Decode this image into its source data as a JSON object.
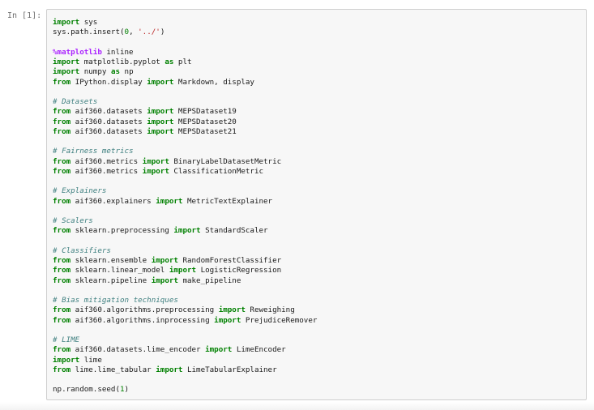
{
  "cell": {
    "prompt": "In [1]:",
    "lines": [
      [
        {
          "t": "import",
          "c": "kw"
        },
        {
          "t": " sys",
          "c": ""
        }
      ],
      [
        {
          "t": "sys.path.insert(",
          "c": ""
        },
        {
          "t": "0",
          "c": "num"
        },
        {
          "t": ", ",
          "c": ""
        },
        {
          "t": "'../'",
          "c": "str"
        },
        {
          "t": ")",
          "c": ""
        }
      ],
      [],
      [
        {
          "t": "%matplotlib",
          "c": "mg"
        },
        {
          "t": " inline",
          "c": ""
        }
      ],
      [
        {
          "t": "import",
          "c": "kw"
        },
        {
          "t": " matplotlib.pyplot ",
          "c": ""
        },
        {
          "t": "as",
          "c": "kw"
        },
        {
          "t": " plt",
          "c": ""
        }
      ],
      [
        {
          "t": "import",
          "c": "kw"
        },
        {
          "t": " numpy ",
          "c": ""
        },
        {
          "t": "as",
          "c": "kw"
        },
        {
          "t": " np",
          "c": ""
        }
      ],
      [
        {
          "t": "from",
          "c": "kw"
        },
        {
          "t": " IPython.display ",
          "c": ""
        },
        {
          "t": "import",
          "c": "kw"
        },
        {
          "t": " Markdown, display",
          "c": ""
        }
      ],
      [],
      [
        {
          "t": "# Datasets",
          "c": "cm"
        }
      ],
      [
        {
          "t": "from",
          "c": "kw"
        },
        {
          "t": " aif360.datasets ",
          "c": ""
        },
        {
          "t": "import",
          "c": "kw"
        },
        {
          "t": " MEPSDataset19",
          "c": ""
        }
      ],
      [
        {
          "t": "from",
          "c": "kw"
        },
        {
          "t": " aif360.datasets ",
          "c": ""
        },
        {
          "t": "import",
          "c": "kw"
        },
        {
          "t": " MEPSDataset20",
          "c": ""
        }
      ],
      [
        {
          "t": "from",
          "c": "kw"
        },
        {
          "t": " aif360.datasets ",
          "c": ""
        },
        {
          "t": "import",
          "c": "kw"
        },
        {
          "t": " MEPSDataset21",
          "c": ""
        }
      ],
      [],
      [
        {
          "t": "# Fairness metrics",
          "c": "cm"
        }
      ],
      [
        {
          "t": "from",
          "c": "kw"
        },
        {
          "t": " aif360.metrics ",
          "c": ""
        },
        {
          "t": "import",
          "c": "kw"
        },
        {
          "t": " BinaryLabelDatasetMetric",
          "c": ""
        }
      ],
      [
        {
          "t": "from",
          "c": "kw"
        },
        {
          "t": " aif360.metrics ",
          "c": ""
        },
        {
          "t": "import",
          "c": "kw"
        },
        {
          "t": " ClassificationMetric",
          "c": ""
        }
      ],
      [],
      [
        {
          "t": "# Explainers",
          "c": "cm"
        }
      ],
      [
        {
          "t": "from",
          "c": "kw"
        },
        {
          "t": " aif360.explainers ",
          "c": ""
        },
        {
          "t": "import",
          "c": "kw"
        },
        {
          "t": " MetricTextExplainer",
          "c": ""
        }
      ],
      [],
      [
        {
          "t": "# Scalers",
          "c": "cm"
        }
      ],
      [
        {
          "t": "from",
          "c": "kw"
        },
        {
          "t": " sklearn.preprocessing ",
          "c": ""
        },
        {
          "t": "import",
          "c": "kw"
        },
        {
          "t": " StandardScaler",
          "c": ""
        }
      ],
      [],
      [
        {
          "t": "# Classifiers",
          "c": "cm"
        }
      ],
      [
        {
          "t": "from",
          "c": "kw"
        },
        {
          "t": " sklearn.ensemble ",
          "c": ""
        },
        {
          "t": "import",
          "c": "kw"
        },
        {
          "t": " RandomForestClassifier",
          "c": ""
        }
      ],
      [
        {
          "t": "from",
          "c": "kw"
        },
        {
          "t": " sklearn.linear_model ",
          "c": ""
        },
        {
          "t": "import",
          "c": "kw"
        },
        {
          "t": " LogisticRegression",
          "c": ""
        }
      ],
      [
        {
          "t": "from",
          "c": "kw"
        },
        {
          "t": " sklearn.pipeline ",
          "c": ""
        },
        {
          "t": "import",
          "c": "kw"
        },
        {
          "t": " make_pipeline",
          "c": ""
        }
      ],
      [],
      [
        {
          "t": "# Bias mitigation techniques",
          "c": "cm"
        }
      ],
      [
        {
          "t": "from",
          "c": "kw"
        },
        {
          "t": " aif360.algorithms.preprocessing ",
          "c": ""
        },
        {
          "t": "import",
          "c": "kw"
        },
        {
          "t": " Reweighing",
          "c": ""
        }
      ],
      [
        {
          "t": "from",
          "c": "kw"
        },
        {
          "t": " aif360.algorithms.inprocessing ",
          "c": ""
        },
        {
          "t": "import",
          "c": "kw"
        },
        {
          "t": " PrejudiceRemover",
          "c": ""
        }
      ],
      [],
      [
        {
          "t": "# LIME",
          "c": "cm"
        }
      ],
      [
        {
          "t": "from",
          "c": "kw"
        },
        {
          "t": " aif360.datasets.lime_encoder ",
          "c": ""
        },
        {
          "t": "import",
          "c": "kw"
        },
        {
          "t": " LimeEncoder",
          "c": ""
        }
      ],
      [
        {
          "t": "import",
          "c": "kw"
        },
        {
          "t": " lime",
          "c": ""
        }
      ],
      [
        {
          "t": "from",
          "c": "kw"
        },
        {
          "t": " lime.lime_tabular ",
          "c": ""
        },
        {
          "t": "import",
          "c": "kw"
        },
        {
          "t": " LimeTabularExplainer",
          "c": ""
        }
      ],
      [],
      [
        {
          "t": "np.random.seed(",
          "c": ""
        },
        {
          "t": "1",
          "c": "num"
        },
        {
          "t": ")",
          "c": ""
        }
      ]
    ]
  },
  "colors": {
    "keyword": "#008000",
    "comment": "#408080",
    "magic": "#aa22ff",
    "string": "#ba2121",
    "cell_background": "#f7f7f7",
    "cell_border": "#cfcfcf",
    "prompt": "#6f6f6f"
  }
}
